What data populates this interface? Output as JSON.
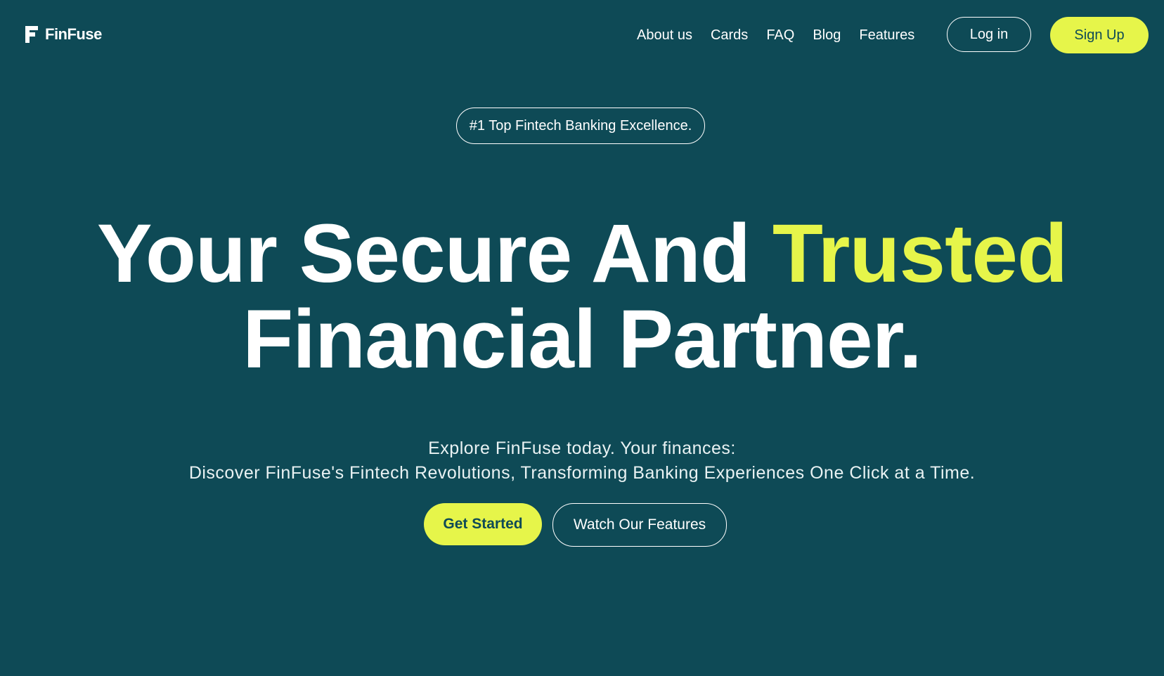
{
  "brand": {
    "name": "FinFuse",
    "logo_icon": "finfuse-f-logo-icon"
  },
  "nav": {
    "links": [
      "About us",
      "Cards",
      "FAQ",
      "Blog",
      "Features"
    ],
    "login_label": "Log in",
    "signup_label": "Sign Up"
  },
  "hero": {
    "badge": "#1 Top Fintech Banking Excellence.",
    "headline_part1": "Your Secure And",
    "headline_accent": "Trusted",
    "headline_part2": "Financial Partner.",
    "subtext_line1": "Explore FinFuse today. Your finances:",
    "subtext_line2": "Discover FinFuse's Fintech Revolutions, Transforming Banking Experiences One Click at a Time.",
    "primary_cta": "Get Started",
    "secondary_cta": "Watch Our Features"
  },
  "colors": {
    "background": "#0e4a56",
    "accent": "#e6f54a",
    "text": "#ffffff"
  }
}
